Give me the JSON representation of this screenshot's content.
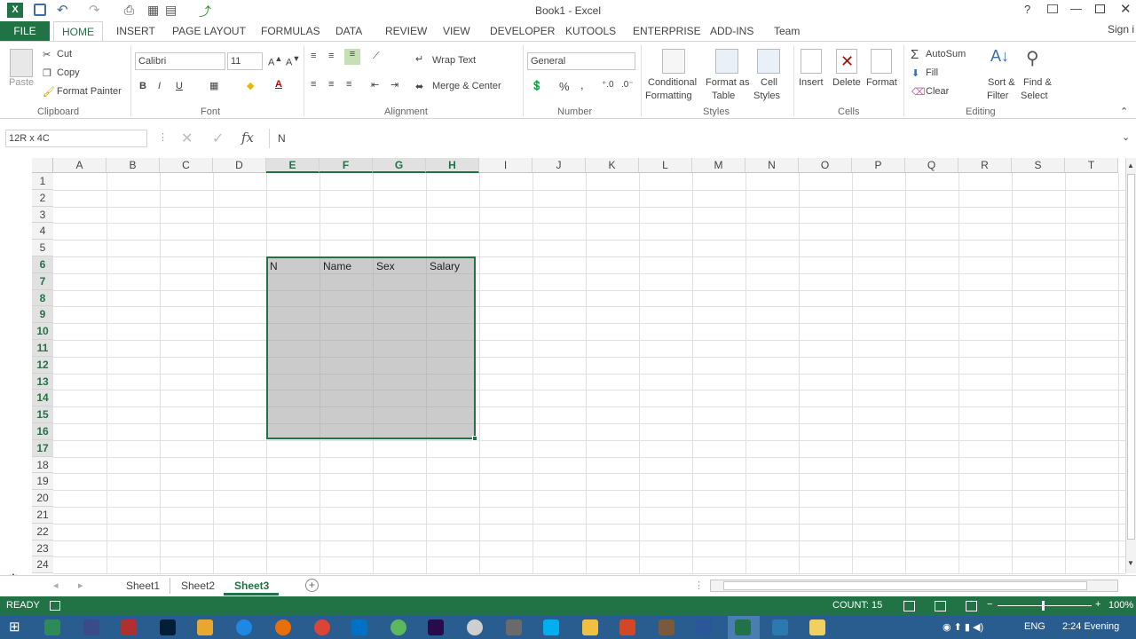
{
  "window": {
    "title": "Book1 - Excel",
    "sign_in": "Sign i"
  },
  "ribbon_tabs": [
    "FILE",
    "HOME",
    "INSERT",
    "PAGE LAYOUT",
    "FORMULAS",
    "DATA",
    "REVIEW",
    "VIEW",
    "DEVELOPER",
    "KUTOOLS",
    "ENTERPRISE",
    "ADD-INS",
    "Team"
  ],
  "clipboard": {
    "paste": "Paste",
    "cut": "Cut",
    "copy": "Copy",
    "format_painter": "Format Painter",
    "label": "Clipboard"
  },
  "font": {
    "name": "Calibri",
    "size": "11",
    "label": "Font",
    "bold": "B",
    "italic": "I",
    "underline": "U",
    "color_letter": "A"
  },
  "alignment": {
    "wrap": "Wrap Text",
    "merge": "Merge & Center",
    "label": "Alignment"
  },
  "number": {
    "format": "General",
    "percent": "%",
    "comma": ",",
    "label": "Number"
  },
  "styles": {
    "conditional": "Conditional",
    "conditional2": "Formatting",
    "format_as": "Format as",
    "format_as2": "Table",
    "cell": "Cell",
    "cell2": "Styles",
    "label": "Styles"
  },
  "cells": {
    "insert": "Insert",
    "delete": "Delete",
    "format": "Format",
    "label": "Cells"
  },
  "editing": {
    "autosum": "AutoSum",
    "fill": "Fill",
    "clear": "Clear",
    "sort": "Sort &",
    "sort2": "Filter",
    "find": "Find &",
    "find2": "Select",
    "label": "Editing"
  },
  "formula_bar": {
    "name_box": "12R x 4C",
    "fx": "fx",
    "content": "N"
  },
  "columns": [
    "A",
    "B",
    "C",
    "D",
    "E",
    "F",
    "G",
    "H",
    "I",
    "J",
    "K",
    "L",
    "M",
    "N",
    "O",
    "P",
    "Q",
    "R",
    "S",
    "T"
  ],
  "rows": [
    "1",
    "2",
    "3",
    "4",
    "5",
    "6",
    "7",
    "8",
    "9",
    "10",
    "11",
    "12",
    "13",
    "14",
    "15",
    "16",
    "17",
    "18",
    "19",
    "20",
    "21",
    "22",
    "23",
    "24"
  ],
  "cells_content": {
    "e6": "N",
    "f6": "Name",
    "g6": "Sex",
    "h6": "Salary"
  },
  "sheets": [
    "Sheet1",
    "Sheet2",
    "Sheet3"
  ],
  "status": {
    "ready": "READY",
    "count": "COUNT: 15",
    "zoom": "100%"
  },
  "taskbar": {
    "lang": "ENG",
    "time": "2:24 Evening"
  },
  "colors": {
    "accent": "#217346",
    "selection": "#a0a0a0"
  }
}
